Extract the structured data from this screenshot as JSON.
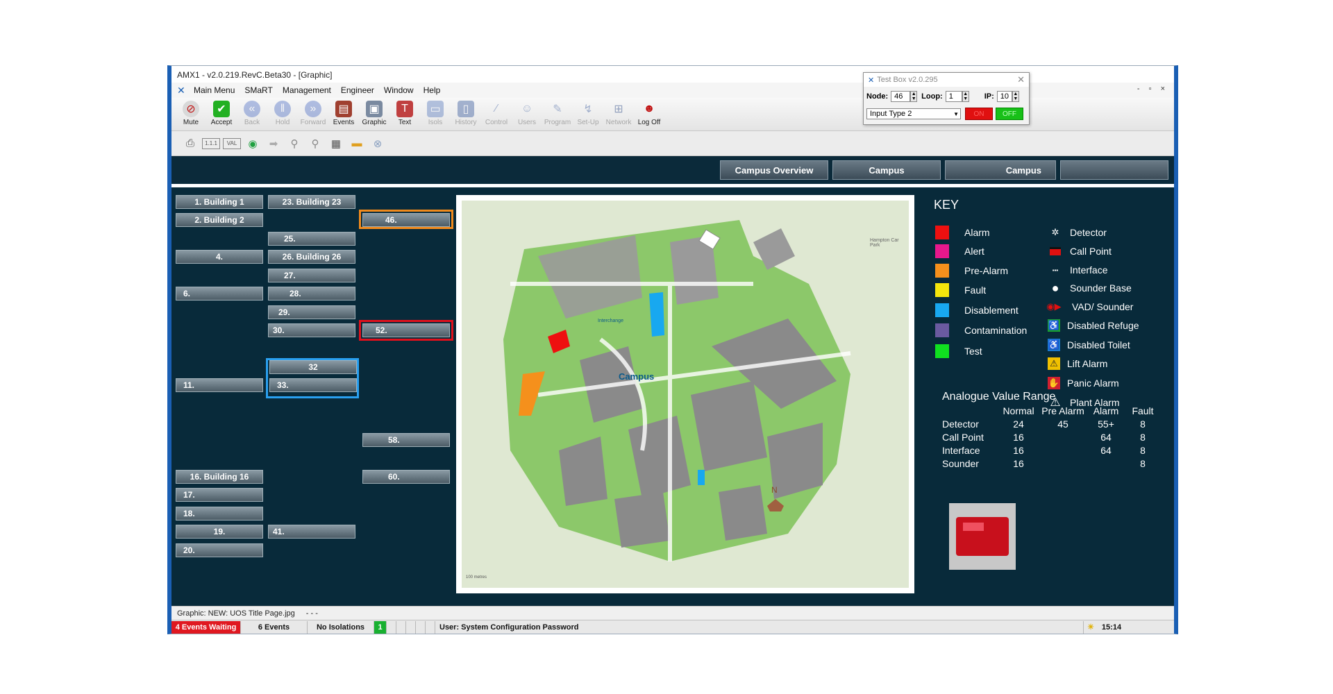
{
  "window": {
    "title": "AMX1 - v2.0.219.RevC.Beta30 - [Graphic]",
    "controls": "- ▫ ×"
  },
  "menu": [
    "Main Menu",
    "SMaRT",
    "Management",
    "Engineer",
    "Window",
    "Help"
  ],
  "toolbar": [
    {
      "label": "Mute",
      "icon": "mute-icon",
      "enabled": true
    },
    {
      "label": "Accept",
      "icon": "accept-icon",
      "enabled": true
    },
    {
      "label": "Back",
      "icon": "back-icon",
      "enabled": false
    },
    {
      "label": "Hold",
      "icon": "hold-icon",
      "enabled": false
    },
    {
      "label": "Forward",
      "icon": "forward-icon",
      "enabled": false
    },
    {
      "label": "Events",
      "icon": "events-icon",
      "enabled": true
    },
    {
      "label": "Graphic",
      "icon": "graphic-icon",
      "enabled": true
    },
    {
      "label": "Text",
      "icon": "text-icon",
      "enabled": true
    },
    {
      "label": "Isols",
      "icon": "isols-icon",
      "enabled": false
    },
    {
      "label": "History",
      "icon": "history-icon",
      "enabled": false
    },
    {
      "label": "Control",
      "icon": "control-icon",
      "enabled": false
    },
    {
      "label": "Users",
      "icon": "users-icon",
      "enabled": false
    },
    {
      "label": "Program",
      "icon": "program-icon",
      "enabled": false
    },
    {
      "label": "Set-Up",
      "icon": "setup-icon",
      "enabled": false
    },
    {
      "label": "Network",
      "icon": "network-icon",
      "enabled": false
    },
    {
      "label": "Log Off",
      "icon": "logoff-icon",
      "enabled": true
    }
  ],
  "toolbar2_labels": {
    "t1": "1.1.1",
    "t2": "VAL"
  },
  "nav": {
    "b1": "Campus Overview",
    "b2": "Campus",
    "b3": "Campus",
    "b4": ""
  },
  "buildings": {
    "c1": [
      "1. Building 1",
      "2. Building 2",
      "4.",
      "6.",
      "11.",
      "16. Building 16",
      "17.",
      "18.",
      "19.",
      "20."
    ],
    "c2": [
      "23. Building 23",
      "25.",
      "26. Building 26",
      "27.",
      "28.",
      "29.",
      "30.",
      "32",
      "33.",
      "41."
    ],
    "c3": [
      "46.",
      "52.",
      "58.",
      "60."
    ]
  },
  "map_labels": {
    "campus": "Campus",
    "interchange": "Interchange",
    "hampton": "Hampton Car Park",
    "north": "N",
    "scale": "100 metres"
  },
  "key": {
    "title": "KEY",
    "colors": [
      {
        "label": "Alarm",
        "color": "#ee1010"
      },
      {
        "label": "Alert",
        "color": "#e8188c"
      },
      {
        "label": "Pre-Alarm",
        "color": "#f5901c"
      },
      {
        "label": "Fault",
        "color": "#f5e60c"
      },
      {
        "label": "Disablement",
        "color": "#18a8f0"
      },
      {
        "label": "Contamination",
        "color": "#6a5aa0"
      },
      {
        "label": "Test",
        "color": "#10e020"
      }
    ],
    "icons": [
      {
        "label": "Detector",
        "icon": "detector-icon"
      },
      {
        "label": "Call Point",
        "icon": "call-point-icon"
      },
      {
        "label": "Interface",
        "icon": "interface-icon"
      },
      {
        "label": "Sounder Base",
        "icon": "sounder-base-icon"
      },
      {
        "label": "VAD/ Sounder",
        "icon": "vad-sounder-icon"
      },
      {
        "label": "Disabled Refuge",
        "icon": "disabled-refuge-icon"
      },
      {
        "label": "Disabled Toilet",
        "icon": "disabled-toilet-icon"
      },
      {
        "label": "Lift Alarm",
        "icon": "lift-alarm-icon"
      },
      {
        "label": "Panic Alarm",
        "icon": "panic-alarm-icon"
      },
      {
        "label": "Plant Alarm",
        "icon": "plant-alarm-icon"
      }
    ]
  },
  "avr": {
    "title": "Analogue Value Range",
    "headers": [
      "",
      "Normal",
      "Pre Alarm",
      "Alarm",
      "Fault"
    ],
    "rows": [
      [
        "Detector",
        "24",
        "45",
        "55+",
        "8"
      ],
      [
        "Call Point",
        "16",
        "",
        "64",
        "8"
      ],
      [
        "Interface",
        "16",
        "",
        "64",
        "8"
      ],
      [
        "Sounder",
        "16",
        "",
        "",
        "8"
      ]
    ]
  },
  "status1": {
    "graphic": "Graphic: NEW: UOS Title Page.jpg",
    "extra": "- - -"
  },
  "status2": {
    "events_waiting": "4 Events Waiting",
    "events": "6 Events",
    "isolations": "No Isolations",
    "indicator": "1",
    "user": "User: System Configuration Password",
    "time": "15:14"
  },
  "testbox": {
    "title": "Test Box v2.0.295",
    "node_label": "Node:",
    "node": "46",
    "loop_label": "Loop:",
    "loop": "1",
    "ip_label": "IP:",
    "ip": "10",
    "input_type": "Input Type 2",
    "on": "ON",
    "off": "OFF"
  }
}
